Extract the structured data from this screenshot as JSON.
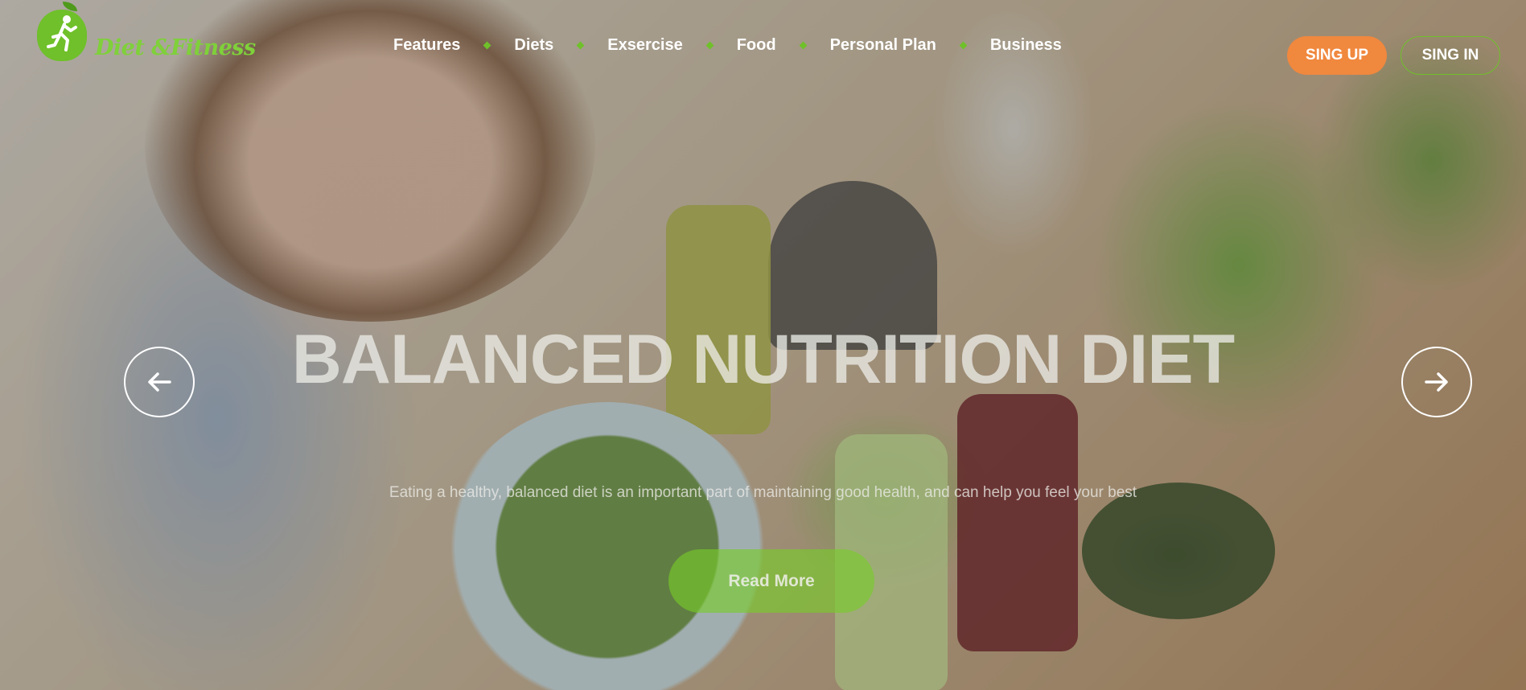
{
  "brand": {
    "name": "Diet &Fitness"
  },
  "nav": {
    "items": [
      {
        "label": "Features"
      },
      {
        "label": "Diets"
      },
      {
        "label": "Exsercise"
      },
      {
        "label": "Food"
      },
      {
        "label": "Personal Plan"
      },
      {
        "label": "Business"
      }
    ]
  },
  "auth": {
    "signup_label": "SING UP",
    "signin_label": "SING IN"
  },
  "hero": {
    "headline": "BALANCED NUTRITION DIET",
    "subtitle": "Eating a healthy, balanced diet is an important part of maintaining good health, and can help you feel your best",
    "cta_label": "Read More"
  },
  "carousel": {
    "prev_icon": "arrow-left-icon",
    "next_icon": "arrow-right-icon"
  },
  "colors": {
    "accent_green": "#6fc02a",
    "signup_orange": "#f0883e",
    "read_more_green": "#78cd28"
  }
}
